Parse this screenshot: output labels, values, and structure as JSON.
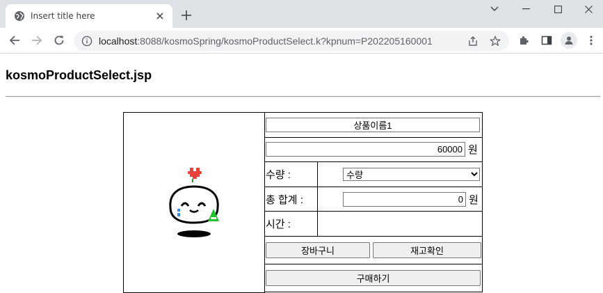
{
  "browser": {
    "tab_title": "Insert title here",
    "url_host": "localhost",
    "url_rest": ":8088/kosmoSpring/kosmoProductSelect.k?kpnum=P202205160001"
  },
  "page": {
    "heading": "kosmoProductSelect.jsp"
  },
  "product": {
    "name": "상품이름1",
    "price": "60000",
    "price_unit": "원",
    "quantity_label": "수량 :",
    "quantity_selected": "수량",
    "total_label": "총 합계 :",
    "total_value": "0",
    "total_unit": "원",
    "time_label": "시간 :",
    "time_value": "",
    "cart_button": "장바구니",
    "stock_button": "재고확인",
    "buy_button": "구매하기",
    "image_icon": "cartoon-mascot-icon"
  },
  "colors": {
    "tabstrip": "#dee1e6",
    "button_bg": "#efefef"
  }
}
